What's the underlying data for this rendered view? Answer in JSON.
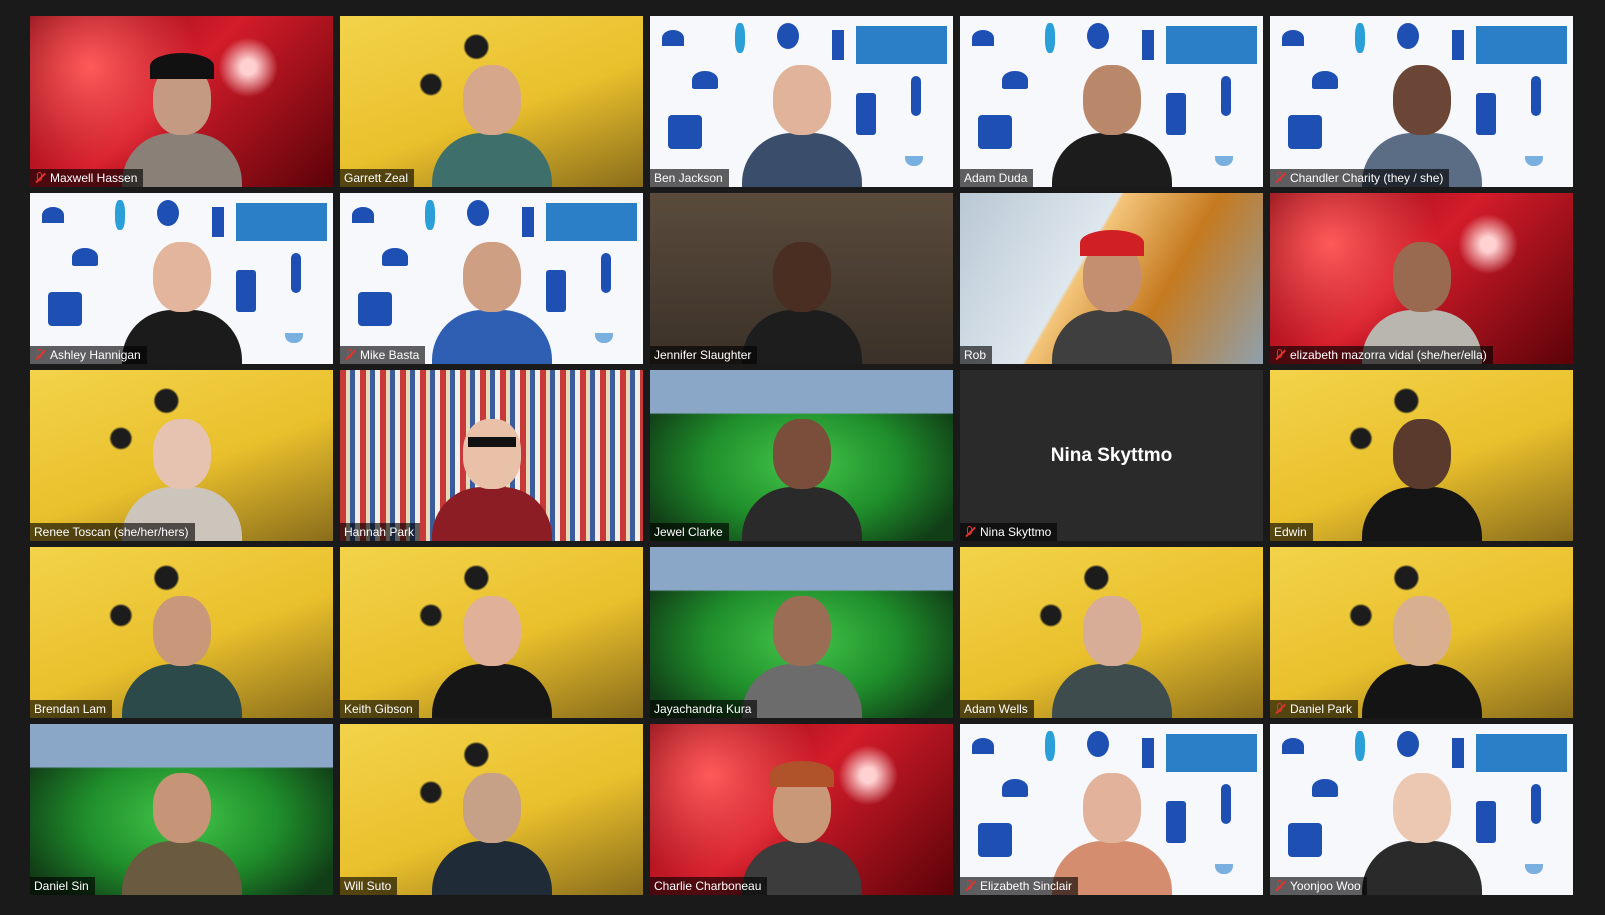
{
  "participants": [
    {
      "name": "Maxwell Hassen",
      "muted": true,
      "bg": "raw",
      "skin": "#c49a82",
      "shirt": "#8a8078",
      "hat": "#111111"
    },
    {
      "name": "Garrett Zeal",
      "muted": false,
      "bg": "sponge",
      "skin": "#d7a78b",
      "shirt": "#3e6f6a"
    },
    {
      "name": "Ben Jackson",
      "muted": false,
      "bg": "blue",
      "skin": "#e0b39a",
      "shirt": "#3a4d6a"
    },
    {
      "name": "Adam Duda",
      "muted": false,
      "bg": "blue",
      "skin": "#b9876a",
      "shirt": "#1c1c1c"
    },
    {
      "name": "Chandler Charity (they / she)",
      "muted": true,
      "bg": "blue",
      "skin": "#6b4636",
      "shirt": "#5a6d85"
    },
    {
      "name": "Ashley Hannigan",
      "muted": true,
      "bg": "blue",
      "skin": "#e2b59c",
      "shirt": "#1b1b1b"
    },
    {
      "name": "Mike Basta",
      "muted": true,
      "bg": "blue",
      "skin": "#cf9f84",
      "shirt": "#2f5fb2"
    },
    {
      "name": "Jennifer Slaughter",
      "muted": false,
      "bg": "room",
      "skin": "#4a2e22",
      "shirt": "#1d1d1d"
    },
    {
      "name": "Rob",
      "muted": false,
      "bg": "office",
      "skin": "#c48f70",
      "shirt": "#3f3f3f",
      "hat": "#d01f25"
    },
    {
      "name": "elizabeth mazorra vidal (she/her/ella)",
      "muted": true,
      "bg": "raw",
      "skin": "#9a6a50",
      "shirt": "#b9b6b0"
    },
    {
      "name": "Renee Toscan (she/her/hers)",
      "muted": false,
      "bg": "sponge",
      "skin": "#e6c2b0",
      "shirt": "#ccc5bb"
    },
    {
      "name": "Hannah Park",
      "muted": false,
      "bg": "books",
      "skin": "#e9c1a8",
      "shirt": "#8d1d25",
      "active": true
    },
    {
      "name": "Jewel Clarke",
      "muted": false,
      "bg": "car",
      "skin": "#7a4e3a",
      "shirt": "#2a2a2a"
    },
    {
      "name": "Nina Skyttmo",
      "muted": true,
      "bg": "empty",
      "video_off": true
    },
    {
      "name": "Edwin",
      "muted": false,
      "bg": "sponge",
      "skin": "#5a3a2c",
      "shirt": "#151515"
    },
    {
      "name": "Brendan Lam",
      "muted": false,
      "bg": "sponge",
      "skin": "#c9987a",
      "shirt": "#2d4a4a"
    },
    {
      "name": "Keith Gibson",
      "muted": false,
      "bg": "sponge",
      "skin": "#e0b098",
      "shirt": "#161616"
    },
    {
      "name": "Jayachandra Kura",
      "muted": false,
      "bg": "car",
      "skin": "#9c6d55",
      "shirt": "#6c6c6c"
    },
    {
      "name": "Adam Wells",
      "muted": false,
      "bg": "sponge",
      "skin": "#d8ad98",
      "shirt": "#3e4c4e"
    },
    {
      "name": "Daniel Park",
      "muted": true,
      "bg": "sponge",
      "skin": "#d9b08f",
      "shirt": "#141414"
    },
    {
      "name": "Daniel Sin",
      "muted": false,
      "bg": "car",
      "skin": "#c69476",
      "shirt": "#6a5a3f"
    },
    {
      "name": "Will Suto",
      "muted": false,
      "bg": "sponge",
      "skin": "#c7a187",
      "shirt": "#1f2b36"
    },
    {
      "name": "Charlie Charboneau",
      "muted": false,
      "bg": "raw",
      "skin": "#c99878",
      "shirt": "#3c3c3c",
      "hat": "#b0522a"
    },
    {
      "name": "Elizabeth Sinclair",
      "muted": true,
      "bg": "blue",
      "skin": "#e2b39a",
      "shirt": "#d58d6f"
    },
    {
      "name": "Yoonjoo Woo",
      "muted": true,
      "bg": "blue",
      "skin": "#ecc8b2",
      "shirt": "#2a2a2a"
    }
  ],
  "colors": {
    "active_speaker_border": "#e4e86a",
    "muted_icon": "#e5312c",
    "background": "#1a1a1a"
  }
}
